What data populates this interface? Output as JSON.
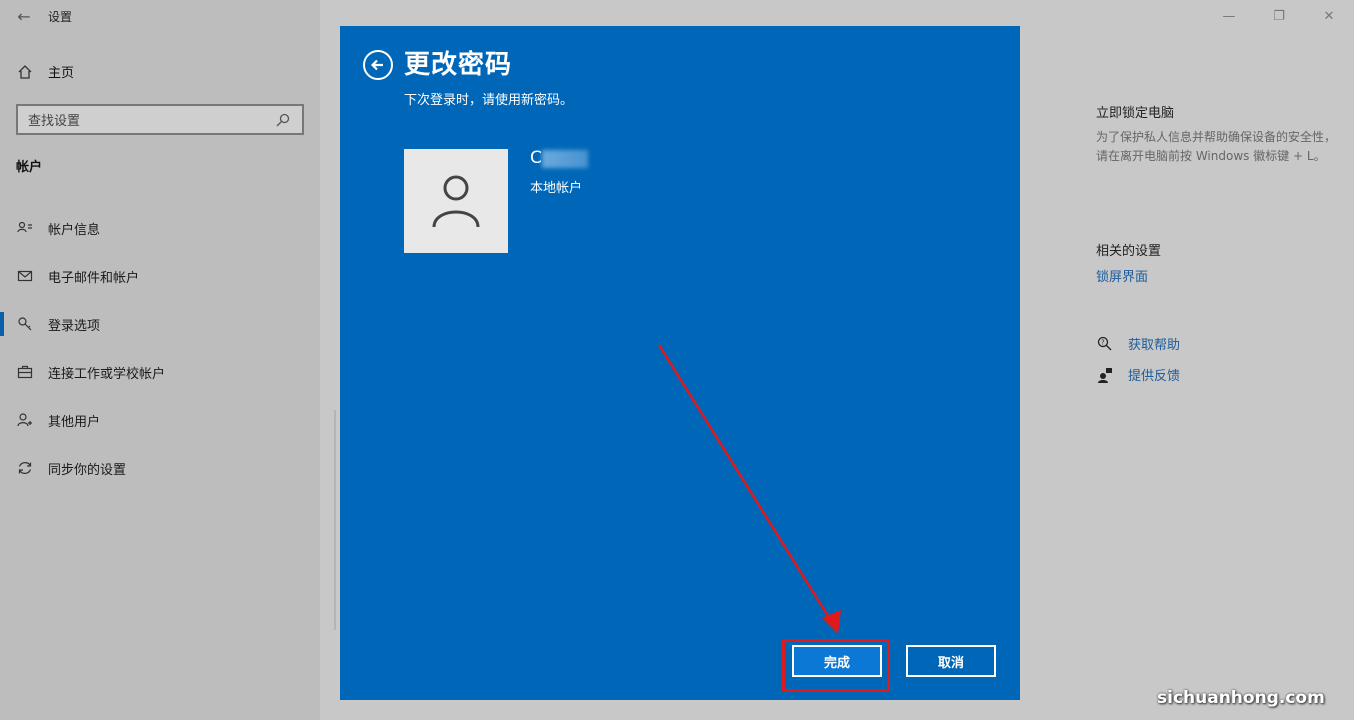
{
  "window": {
    "title": "设置",
    "controls": {
      "minimize": "—",
      "restore": "❐",
      "close": "✕"
    }
  },
  "sidebar": {
    "home_label": "主页",
    "search_placeholder": "查找设置",
    "section_title": "帐户",
    "items": [
      {
        "label": "帐户信息",
        "icon": "person-card-icon"
      },
      {
        "label": "电子邮件和帐户",
        "icon": "mail-icon"
      },
      {
        "label": "登录选项",
        "icon": "key-icon",
        "active": true
      },
      {
        "label": "连接工作或学校帐户",
        "icon": "briefcase-icon"
      },
      {
        "label": "其他用户",
        "icon": "person-add-icon"
      },
      {
        "label": "同步你的设置",
        "icon": "sync-icon"
      }
    ]
  },
  "right_panel": {
    "lock_title": "立即锁定电脑",
    "lock_desc": "为了保护私人信息并帮助确保设备的安全性，请在离开电脑前按 Windows 徽标键 + L。",
    "related_title": "相关的设置",
    "related_link": "锁屏界面",
    "help_link": "获取帮助",
    "feedback_link": "提供反馈"
  },
  "dialog": {
    "title": "更改密码",
    "subtitle": "下次登录时，请使用新密码。",
    "user_name_visible": "C",
    "account_type": "本地帐户",
    "done_label": "完成",
    "cancel_label": "取消"
  },
  "watermark": "sichuanhong.com",
  "colors": {
    "dialog_bg": "#0067b8",
    "highlight": "#e01a1a",
    "link": "#1d5c9a"
  }
}
